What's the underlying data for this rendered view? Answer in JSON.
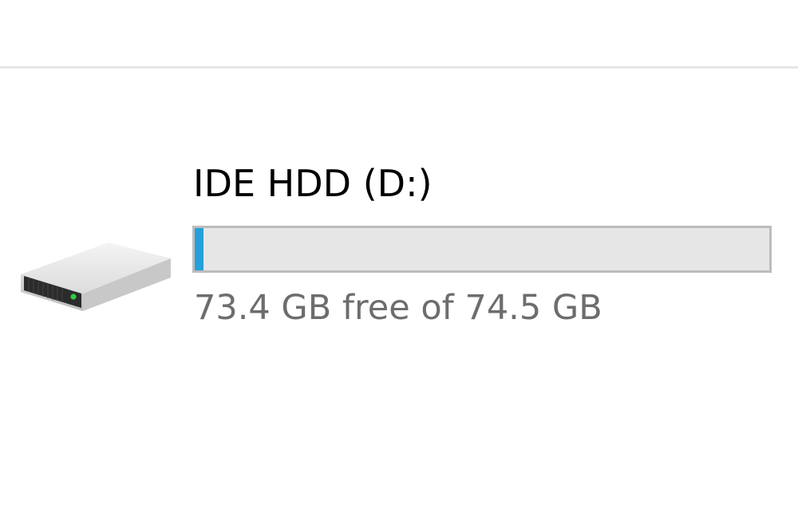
{
  "drive": {
    "name": "IDE HDD (D:)",
    "free_text": "73.4 GB free of 74.5 GB",
    "free_gb": 73.4,
    "total_gb": 74.5,
    "used_fraction": 0.015,
    "icon": "hard-drive-icon"
  },
  "colors": {
    "bar_background": "#e6e6e6",
    "bar_border": "#bcbcbc",
    "bar_fill": "#26a0da",
    "free_text": "#6d6d6d",
    "status_led": "#2ecc40"
  }
}
